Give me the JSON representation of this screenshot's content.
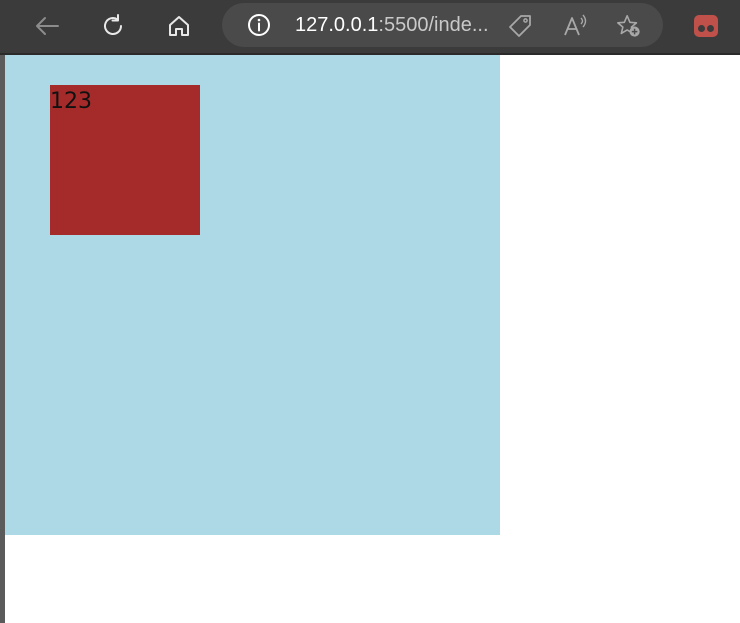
{
  "browser": {
    "toolbar": {
      "back_icon": "arrow-left-icon",
      "refresh_icon": "refresh-icon",
      "home_icon": "home-icon"
    },
    "address_bar": {
      "url_host": "127.0.0.1",
      "url_rest": ":5500/inde...",
      "info_icon": "info-icon",
      "tag_icon": "tag-icon",
      "read_aloud_icon": "read-aloud-icon",
      "favorite_icon": "favorite-add-icon"
    },
    "extension_icon": "extension-icon"
  },
  "page": {
    "inner_box_text": "123"
  },
  "colors": {
    "toolbar_bg": "#3b3b3b",
    "address_bg": "#4a4a4a",
    "outer_box": "#add8e6",
    "inner_box": "#a52a2a",
    "extension": "#c0504a"
  }
}
